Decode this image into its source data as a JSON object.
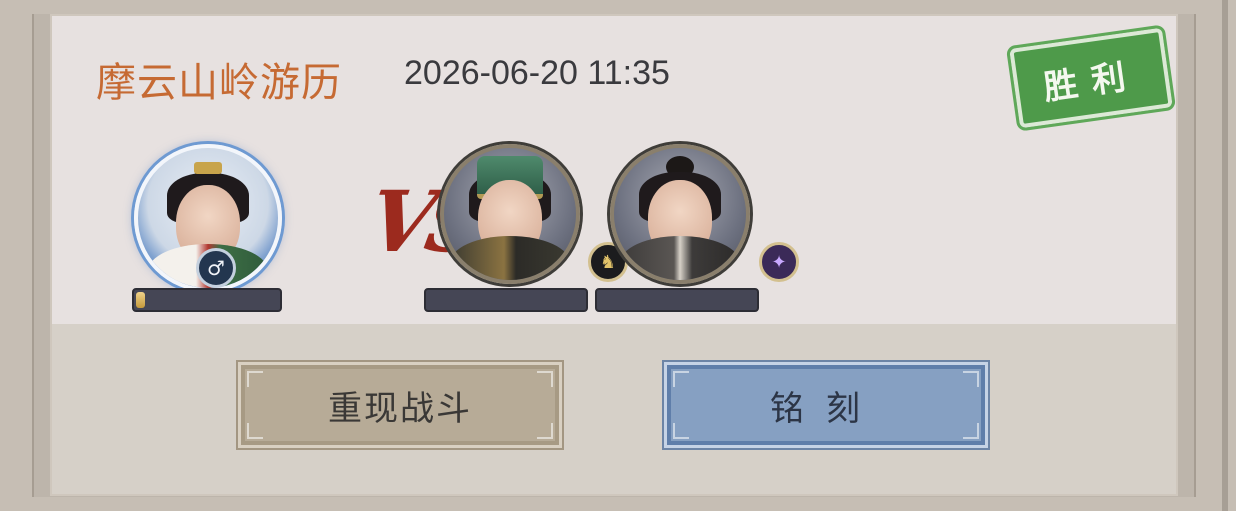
{
  "battle": {
    "title": "摩云山岭游历",
    "datetime": "2026-06-20 11:35",
    "result": "胜利",
    "vs_label": "VS"
  },
  "player": {
    "gender_icon": "♂",
    "hp_fraction": 0.06
  },
  "enemies": [
    {
      "class_icon": "♞",
      "hp_fraction": 0
    },
    {
      "class_icon": "✦",
      "hp_fraction": 0
    }
  ],
  "actions": {
    "replay_label": "重现战斗",
    "engrave_label": "铭刻"
  },
  "colors": {
    "title": "#c66a33",
    "result_stamp": "#4e9a4a",
    "vs": "#9c2a1e",
    "replay_button": "#b7ab97",
    "engrave_button": "#86a0c2",
    "hp_fill": "#c59a3c",
    "hp_empty": "#454655"
  }
}
